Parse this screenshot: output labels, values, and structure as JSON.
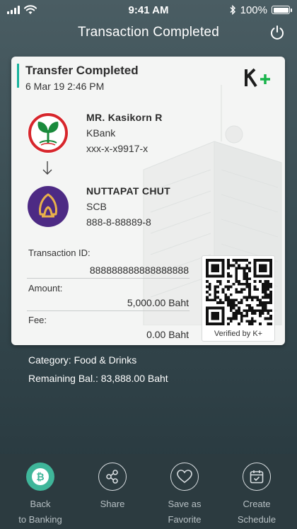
{
  "status_bar": {
    "time": "9:41 AM",
    "battery": "100%",
    "battery_level": 1.0
  },
  "header": {
    "title": "Transaction Completed",
    "power_icon": "power-icon"
  },
  "card": {
    "title": "Transfer Completed",
    "date": "6 Mar 19  2:46 PM",
    "logo_text": "K+",
    "from": {
      "name": "MR. Kasikorn R",
      "bank": "KBank",
      "account": "xxx-x-x9917-x"
    },
    "to": {
      "name": "NUTTAPAT CHUT",
      "bank": "SCB",
      "account": "888-8-88889-8"
    },
    "transaction_id_label": "Transaction ID:",
    "transaction_id": "888888888888888888",
    "amount_label": "Amount:",
    "amount": "5,000.00 Baht",
    "fee_label": "Fee:",
    "fee": "0.00 Baht",
    "qr_caption": "Verified by K+"
  },
  "extra": {
    "category": "Category: Food & Drinks",
    "remaining": "Remaining Bal.: 83,888.00 Baht"
  },
  "bottom_nav": [
    {
      "label": "Back\nto Banking",
      "icon": "bitcoin-icon",
      "active": true
    },
    {
      "label": "Share",
      "icon": "share-icon",
      "active": false
    },
    {
      "label": "Save as\nFavorite",
      "icon": "heart-icon",
      "active": false
    },
    {
      "label": "Create\nSchedule",
      "icon": "calendar-icon",
      "active": false
    }
  ],
  "colors": {
    "accent": "#17b29d",
    "active_nav": "#3fb69a",
    "kbank_green": "#1a8a3c",
    "scb_purple": "#4d2a84",
    "kbank_red": "#d7262c",
    "scb_gold": "#e8b04a"
  }
}
